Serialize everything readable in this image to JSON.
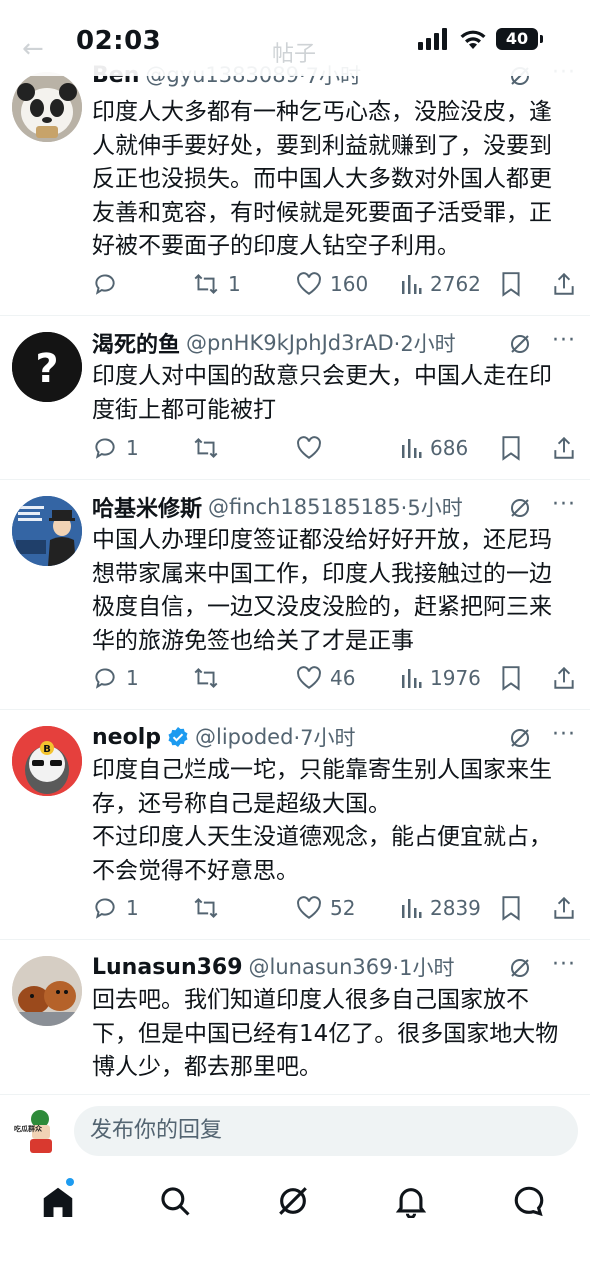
{
  "status_bar": {
    "time": "02:03",
    "battery": "40"
  },
  "page": {
    "title_ghost": "帖子"
  },
  "tweets": [
    {
      "name": "Ben",
      "handle": "@gyu1383089",
      "time": "·7小时",
      "body": "印度人大多都有一种乞丐心态，没脸没皮，逢人就伸手要好处，要到利益就赚到了，没要到反正也没损失。而中国人大多数对外国人都更友善和宽容，有时候就是死要面子活受罪，正好被不要面子的印度人钻空子利用。",
      "replies": "",
      "retweets": "1",
      "likes": "160",
      "views": "2762",
      "avatar": "panda-avatar"
    },
    {
      "name": "渴死的鱼",
      "handle": "@pnHK9kJphJd3rAD",
      "time": "·2小时",
      "body": "印度人对中国的敌意只会更大，中国人走在印度街上都可能被打",
      "replies": "1",
      "retweets": "",
      "likes": "",
      "views": "686",
      "avatar": "question-mark-avatar"
    },
    {
      "name": "哈基米修斯",
      "handle": "@finch185185185",
      "time": "·5小时",
      "body": "中国人办理印度签证都没给好好开放，还尼玛想带家属来中国工作，印度人我接触过的一边极度自信，一边又没皮没脸的，赶紧把阿三来华的旅游免签也给关了才是正事",
      "replies": "1",
      "retweets": "",
      "likes": "46",
      "views": "1976",
      "avatar": "cartoon-man-avatar"
    },
    {
      "name": "neolp",
      "handle": "@lipoded",
      "time": "·7小时",
      "body": "印度自己烂成一坨，只能靠寄生别人国家来生存，还号称自己是超级大国。\n不过印度人天生没道德观念，能占便宜就占，不会觉得不好意思。",
      "replies": "1",
      "retweets": "",
      "likes": "52",
      "views": "2839",
      "verified": true,
      "avatar": "bitcoin-penguin-avatar"
    },
    {
      "name": "Lunasun369",
      "handle": "@lunasun369",
      "time": "·1小时",
      "body": "回去吧。我们知道印度人很多自己国家放不下，但是中国已经有14亿了。很多国家地大物博人少，都去那里吧。",
      "avatar": "dogs-avatar"
    }
  ],
  "reply_bar": {
    "placeholder": "发布你的回复",
    "avatar_text": "吃瓜群众"
  },
  "nav": [
    "home-icon",
    "search-icon",
    "grok-icon",
    "notifications-icon",
    "messages-icon"
  ],
  "colors": {
    "accent": "#1d9bf0",
    "text": "#0f1419",
    "muted": "#536471"
  }
}
